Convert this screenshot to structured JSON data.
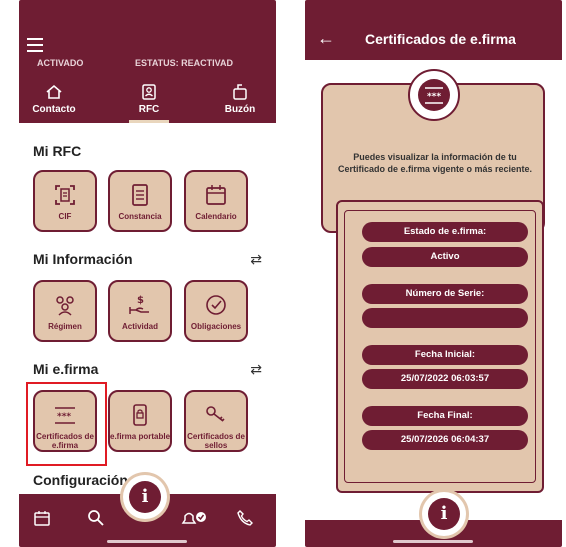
{
  "colors": {
    "brand": "#6f1d33",
    "tile_bg": "#e2c6ad",
    "highlight": "#e01b24"
  },
  "left_screen": {
    "status_banner": {
      "item1": "ACTIVADO",
      "item2": "ESTATUS: REACTIVAD"
    },
    "tabs": [
      {
        "label": "Contacto",
        "icon": "home-icon"
      },
      {
        "label": "RFC",
        "icon": "id-card-icon"
      },
      {
        "label": "Buzón",
        "icon": "mailbox-icon"
      }
    ],
    "sections": {
      "mi_rfc": {
        "title": "Mi RFC",
        "tiles": [
          "CIF",
          "Constancia",
          "Calendario"
        ]
      },
      "mi_informacion": {
        "title": "Mi Información",
        "tiles": [
          "Régimen",
          "Actividad",
          "Obligaciones"
        ]
      },
      "mi_efirma": {
        "title": "Mi e.firma",
        "tiles": [
          "Certificados de e.firma",
          "e.firma portable",
          "Certificados de sellos"
        ]
      },
      "configuracion": {
        "title": "Configuración"
      }
    },
    "bottom_nav": [
      "calendar-icon",
      "search-icon",
      "info-icon",
      "notification-check-icon",
      "phone-icon"
    ],
    "fab_label": "i"
  },
  "right_screen": {
    "title": "Certificados de e.firma",
    "description": "Puedes visualizar la información de tu Certificado de e.firma vigente o más reciente.",
    "badge_label": "***",
    "fields": [
      {
        "label": "Estado de e.firma:",
        "value": "Activo"
      },
      {
        "label": "Número de Serie:",
        "value": ""
      },
      {
        "label": "Fecha Inicial:",
        "value": "25/07/2022 06:03:57"
      },
      {
        "label": "Fecha Final:",
        "value": "25/07/2026 06:04:37"
      }
    ],
    "fab_label": "i"
  }
}
